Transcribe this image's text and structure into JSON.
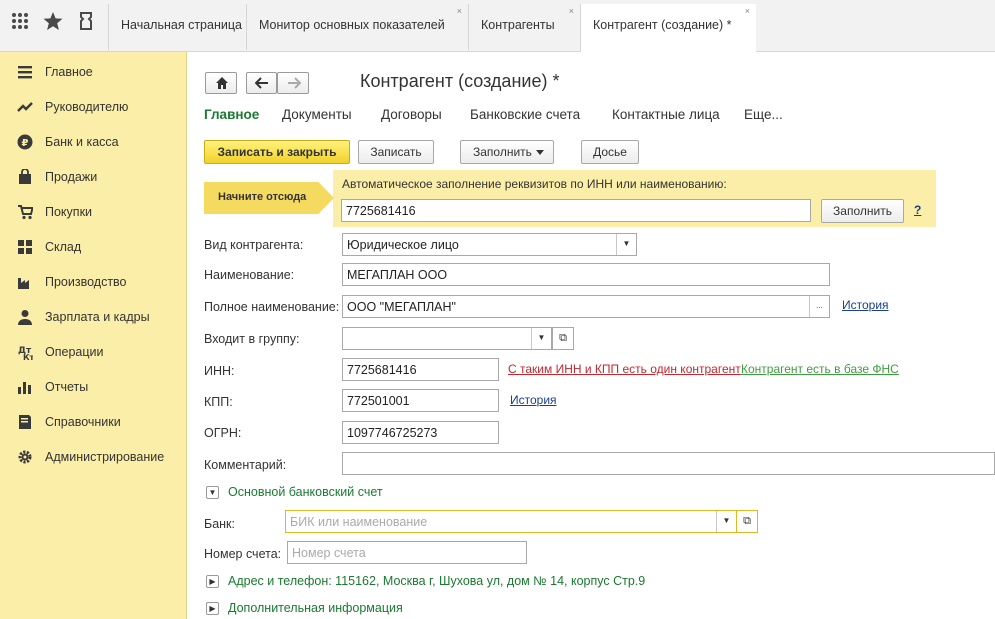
{
  "tabs": [
    {
      "label": "Начальная страница",
      "closable": false
    },
    {
      "label": "Монитор основных показателей",
      "closable": true
    },
    {
      "label": "Контрагенты",
      "closable": true
    },
    {
      "label": "Контрагент (создание) *",
      "closable": true
    }
  ],
  "close_glyph": "×",
  "sidebar": {
    "items": [
      {
        "label": "Главное",
        "icon": "menu-icon"
      },
      {
        "label": "Руководителю",
        "icon": "trend-icon"
      },
      {
        "label": "Банк и касса",
        "icon": "ruble-icon"
      },
      {
        "label": "Продажи",
        "icon": "bag-icon"
      },
      {
        "label": "Покупки",
        "icon": "cart-icon"
      },
      {
        "label": "Склад",
        "icon": "grid-icon"
      },
      {
        "label": "Производство",
        "icon": "factory-icon"
      },
      {
        "label": "Зарплата и кадры",
        "icon": "person-icon"
      },
      {
        "label": "Операции",
        "icon": "operations-icon"
      },
      {
        "label": "Отчеты",
        "icon": "bar-chart-icon"
      },
      {
        "label": "Справочники",
        "icon": "book-icon"
      },
      {
        "label": "Администрирование",
        "icon": "gear-icon"
      }
    ]
  },
  "form": {
    "title": "Контрагент (создание) *",
    "tabs": [
      "Главное",
      "Документы",
      "Договоры",
      "Банковские счета",
      "Контактные лица",
      "Еще..."
    ],
    "buttons": {
      "save_close": "Записать и закрыть",
      "save": "Записать",
      "fill": "Заполнить",
      "dossier": "Досье"
    },
    "hint": {
      "arrow_label": "Начните отсюда",
      "text": "Автоматическое заполнение реквизитов по ИНН или наименованию:",
      "inn_value": "7725681416",
      "fill_button": "Заполнить",
      "help": "?"
    },
    "fields": {
      "kind_label": "Вид контрагента:",
      "kind_value": "Юридическое лицо",
      "name_label": "Наименование:",
      "name_value": "МЕГАПЛАН ООО",
      "fullname_label": "Полное наименование:",
      "fullname_value": "ООО \"МЕГАПЛАН\"",
      "fullname_more": "...",
      "history_link": "История",
      "group_label": "Входит в группу:",
      "group_value": "",
      "inn_label": "ИНН:",
      "inn_value": "7725681416",
      "inn_warning": "С таким ИНН и КПП есть один контрагент",
      "inn_fns": "Контрагент есть в базе ФНС",
      "kpp_label": "КПП:",
      "kpp_value": "772501001",
      "kpp_history": "История",
      "ogrn_label": "ОГРН:",
      "ogrn_value": "1097746725273",
      "comment_label": "Комментарий:",
      "comment_value": ""
    },
    "bank_section": {
      "title": "Основной банковский счет",
      "bank_label": "Банк:",
      "bank_placeholder": "БИК или наименование",
      "account_label": "Номер счета:",
      "account_placeholder": "Номер счета"
    },
    "address_section": "Адрес и телефон: 115162, Москва г, Шухова ул, дом № 14, корпус Стр.9",
    "additional_section": "Дополнительная информация"
  }
}
